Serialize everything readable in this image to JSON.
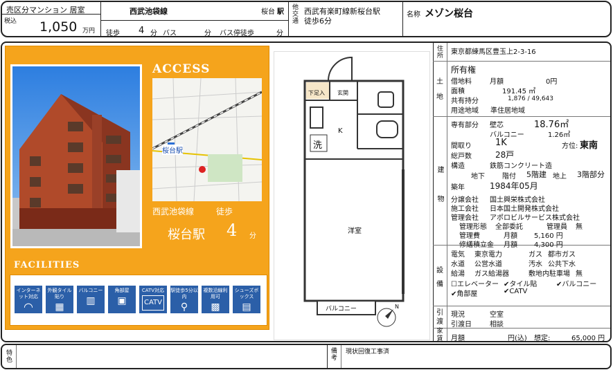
{
  "header": {
    "category": "売区分マンション 居室",
    "tax_label": "税込",
    "price": "1,050",
    "price_unit": "万円",
    "line": "西武池袋線",
    "station": "桜台",
    "station_suffix": "駅",
    "walk_label": "徒歩",
    "walk_min": "4",
    "min_unit": "分",
    "bus_label": "バス",
    "bus_min_unit": "分",
    "bus_stop_label": "バス停徒歩",
    "bus_stop_unit": "分",
    "other_transport_label": "他交通",
    "other_transport_1": "西武有楽町線新桜台駅",
    "other_transport_2": "徒歩6分",
    "name_label": "名称",
    "name": "メゾン桜台"
  },
  "access": {
    "title": "ACCESS",
    "line": "西武池袋線",
    "walk_label": "徒歩",
    "station": "桜台駅",
    "minutes": "4",
    "min_unit": "分",
    "map_label": "桜台駅"
  },
  "facilities": {
    "title": "FACILITIES",
    "items": [
      {
        "label": "インターネット対応",
        "icon": "wifi-icon"
      },
      {
        "label": "外観タイル貼り",
        "icon": "tile-icon"
      },
      {
        "label": "バルコニー",
        "icon": "balcony-icon"
      },
      {
        "label": "角部屋",
        "icon": "corner-room-icon"
      },
      {
        "label": "CATV対応",
        "icon": "tv-icon"
      },
      {
        "label": "駅徒歩5分以内",
        "icon": "walk-icon"
      },
      {
        "label": "複数沿線利用可",
        "icon": "train-icon"
      },
      {
        "label": "シューズボックス",
        "icon": "shoebox-icon"
      }
    ]
  },
  "floorplan": {
    "entrance": "下足入",
    "genkan": "玄関",
    "kitchen": "K",
    "laundry": "洗",
    "room": "洋室",
    "balcony": "バルコニー",
    "north": "N"
  },
  "info": {
    "location_label": "住所",
    "address": "東京都練馬区豊玉上2-3-16",
    "land_label": "土地",
    "ownership": "所有権",
    "leasehold_label": "借地料",
    "monthly": "月額",
    "leasehold_val": "0円",
    "area_label": "面積",
    "area_val": "191.45 ㎡",
    "share_label": "共有持分",
    "share_val": "1,876 / 49,643",
    "zone_label": "用途地域",
    "zone_val": "準住居地域",
    "building_label": "建",
    "exclusive_label": "専有部分",
    "wall_label": "壁芯",
    "exclusive_area": "18.76㎡",
    "balcony_label": "バルコニー",
    "balcony_area": "1.26㎡",
    "layout_label": "間取り",
    "layout": "1K",
    "direction_label": "方位:",
    "direction": "東南",
    "units_label": "総戸数",
    "units": "28戸",
    "structure_label": "構造",
    "structure": "鉄筋コンクリート造",
    "floors_text_1": "地下",
    "floors_text_2": "階付",
    "floors_5": "5階建",
    "floors_ground": "地上",
    "floor_3": "3階部分",
    "built_label": "築年",
    "built": "1984年05月",
    "object_label": "物",
    "seller_label": "分譲会社",
    "seller": "国土興栄株式会社",
    "builder_label": "施工会社",
    "builder": "日本国土開発株式会社",
    "mgmt_label": "管理会社",
    "mgmt": "アポロビルサービス株式会社",
    "mgmt_form_label": "管理形態",
    "mgmt_form": "全部委託",
    "manager_label": "管理員",
    "manager": "無",
    "fee_label": "管理費",
    "fee_month": "月額",
    "fee": "5,160 円",
    "repair_label": "修繕積立金",
    "repair_month": "月額",
    "repair": "4,300 円",
    "equip_label": "設備",
    "elec_label": "電気",
    "elec": "東京電力",
    "gas_label": "ガス",
    "gas": "都市ガス",
    "water_label": "水道",
    "water": "公営水道",
    "sewer_label": "汚水",
    "sewer": "公共下水",
    "hot_label": "給湯",
    "hot": "ガス給湯器",
    "parking_label": "敷地内駐車場",
    "parking": "無",
    "check_elevator": "エレベーター",
    "check_tile": "タイル貼",
    "check_balcony": "バルコニー",
    "check_corner": "角部屋",
    "check_catv": "CATV",
    "handover_label": "引渡",
    "current_label": "現況",
    "current": "空室",
    "handover_date_label": "引渡日",
    "handover_date": "相談",
    "rent_label": "家賃",
    "rent_month": "月額",
    "rent_unit": "円(込)",
    "rent_est_label": "想定:",
    "rent_est": "65,000 円"
  },
  "footer": {
    "special_label": "特色",
    "remarks_label": "備考",
    "remarks": "現状回復工事済"
  }
}
